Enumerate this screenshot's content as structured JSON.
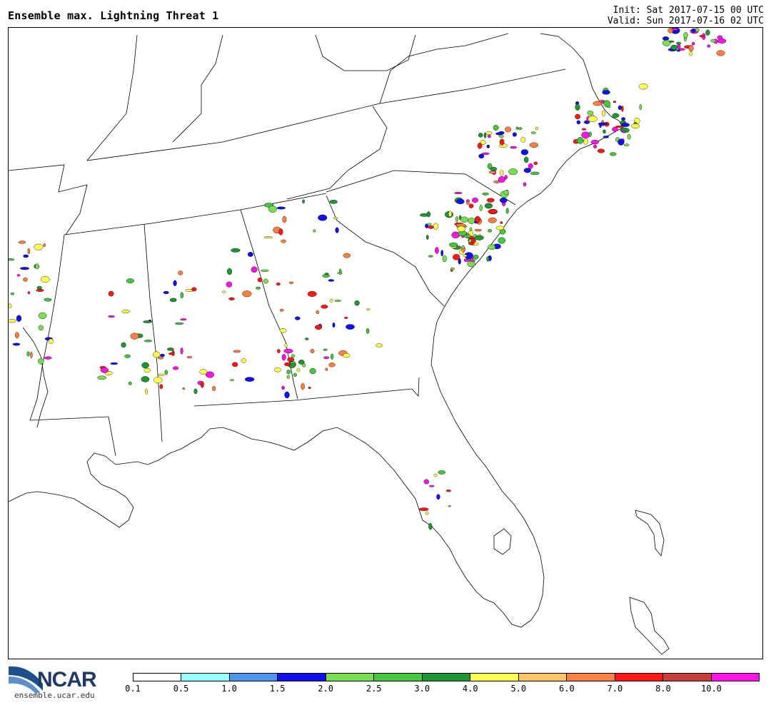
{
  "header": {
    "title": "Ensemble max. Lightning Threat 1",
    "init": "Init: Sat 2017-07-15 00 UTC",
    "valid": "Valid: Sun 2017-07-16 02 UTC"
  },
  "legend": {
    "labels": [
      "0.1",
      "0.5",
      "1.0",
      "1.5",
      "2.0",
      "2.5",
      "3.0",
      "4.0",
      "5.0",
      "6.0",
      "7.0",
      "8.0",
      "10.0"
    ],
    "colors": [
      "#ffffff",
      "#96ffff",
      "#4d96f0",
      "#1010ee",
      "#78e050",
      "#44c840",
      "#1e9632",
      "#ffff50",
      "#ffc864",
      "#ff8040",
      "#ff1818",
      "#c83c3c",
      "#ff14e6"
    ]
  },
  "branding": {
    "logo": "NCAR",
    "url": "ensemble.ucar.edu"
  },
  "map_features": [
    "state-borders",
    "coastline",
    "lightning-threat-contours"
  ],
  "highlight_colors": {
    "border": "#000000",
    "background": "#ffffff"
  }
}
